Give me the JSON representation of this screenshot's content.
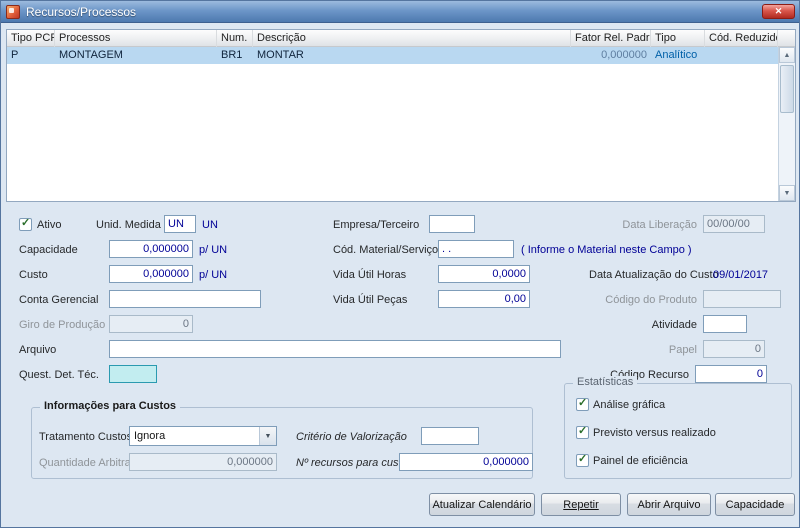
{
  "icons": {
    "close": "✕",
    "check": "✓",
    "combo_arrow": "▼",
    "scroll_up": "▲",
    "scroll_down": "▼"
  },
  "window": {
    "title": "Recursos/Processos"
  },
  "grid": {
    "columns": [
      "Tipo PCP",
      "Processos",
      "Num.",
      "Descrição",
      "Fator Rel. Padrão",
      "Tipo",
      "Cód. Reduzido"
    ],
    "row": {
      "tipo_pcp": "P",
      "processos": "MONTAGEM",
      "num": "BR1",
      "descricao": "MONTAR",
      "fator_rel_padrao": "0,000000",
      "tipo": "Analítico",
      "cod_reduzido": ""
    }
  },
  "form": {
    "ativo": {
      "label": "Ativo",
      "checked": true
    },
    "unid_medida": {
      "label": "Unid. Medida",
      "value": "UN",
      "suffix": "UN"
    },
    "empresa_terceiro": {
      "label": "Empresa/Terceiro",
      "value": ""
    },
    "data_liberacao": {
      "label": "Data Liberação",
      "value": "00/00/00"
    },
    "capacidade": {
      "label": "Capacidade",
      "value": "0,000000",
      "suffix": "p/ UN"
    },
    "cod_material_servico": {
      "label": "Cód. Material/Serviço",
      "value": ". .",
      "hint": "( Informe o Material neste Campo )"
    },
    "custo": {
      "label": "Custo",
      "value": "0,000000",
      "suffix": "p/ UN"
    },
    "vida_util_horas": {
      "label": "Vida Útil Horas",
      "value": "0,0000"
    },
    "data_atualizacao_custo": {
      "label": "Data Atualização do Custo",
      "value": "09/01/2017"
    },
    "conta_gerencial": {
      "label": "Conta Gerencial",
      "value": ""
    },
    "vida_util_pecas": {
      "label": "Vida Útil Peças",
      "value": "0,00"
    },
    "codigo_produto": {
      "label": "Código do Produto",
      "value": ""
    },
    "giro_producao": {
      "label": "Giro de Produção",
      "value": "0"
    },
    "atividade": {
      "label": "Atividade",
      "value": ""
    },
    "arquivo": {
      "label": "Arquivo",
      "value": ""
    },
    "papel": {
      "label": "Papel",
      "value": "0"
    },
    "quest_det_tec": {
      "label": "Quest. Det. Téc.",
      "value": ""
    },
    "codigo_recurso": {
      "label": "Código Recurso",
      "value": "0"
    }
  },
  "custos": {
    "title": "Informações para Custos",
    "tratamento_custos": {
      "label": "Tratamento Custos",
      "value": "Ignora"
    },
    "criterio_valorizacao": {
      "label": "Critério de Valorização",
      "value": ""
    },
    "quantidade_arbitrada": {
      "label": "Quantidade Arbitrada",
      "value": "0,000000"
    },
    "n_recursos_para_custos": {
      "label": "Nº recursos para custos",
      "value": "0,000000"
    }
  },
  "estatisticas": {
    "title": "Estatísticas",
    "items": [
      {
        "label": "Análise gráfica",
        "checked": true
      },
      {
        "label": "Previsto versus realizado",
        "checked": true
      },
      {
        "label": "Painel de eficiência",
        "checked": true
      }
    ]
  },
  "buttons": {
    "atualizar_calendario": "Atualizar Calendário",
    "repetir": "Repetir",
    "abrir_arquivo": "Abrir Arquivo",
    "capacidade": "Capacidade"
  }
}
